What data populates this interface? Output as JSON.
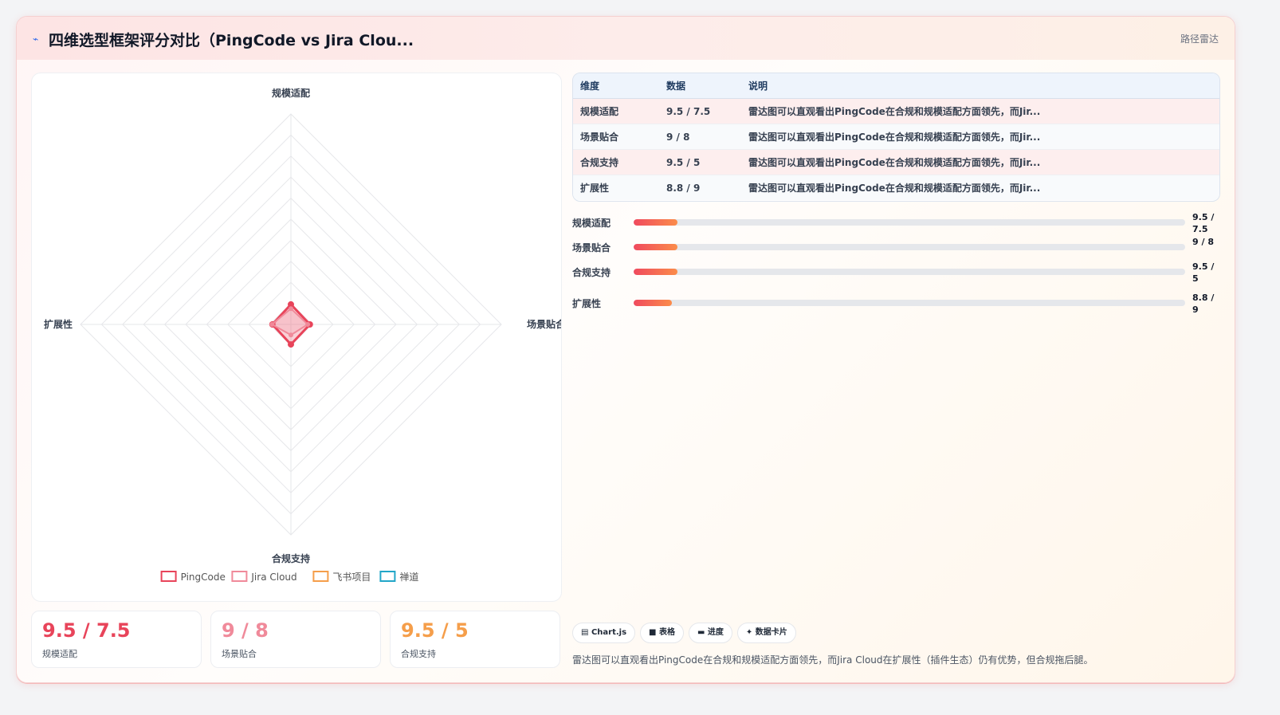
{
  "header": {
    "logo_icon": "chart-trend-icon",
    "title": "四维选型框架评分对比（PingCode vs Jira Clou...",
    "tag": "路径雷达"
  },
  "chart_data": {
    "type": "radar",
    "title": "",
    "axes": [
      "规模适配",
      "场景贴合",
      "合规支持",
      "扩展性"
    ],
    "range": [
      0,
      100
    ],
    "rings": 10,
    "series": [
      {
        "name": "PingCode",
        "values": [
          9.5,
          9,
          9.5,
          8.8
        ],
        "color": "#e8445a"
      },
      {
        "name": "Jira Cloud",
        "values": [
          7.5,
          8,
          5,
          9
        ],
        "color": "#f08a9a"
      },
      {
        "name": "飞书项目",
        "values": [],
        "color": "#f59e4a"
      },
      {
        "name": "禅道",
        "values": [],
        "color": "#22a6c8"
      }
    ],
    "legend_position": "bottom"
  },
  "table": {
    "headers": [
      "维度",
      "数据",
      "说明"
    ],
    "rows": [
      {
        "dim": "规模适配",
        "value": "9.5 / 7.5",
        "note": "雷达图可以直观看出PingCode在合规和规模适配方面领先，而Jir..."
      },
      {
        "dim": "场景贴合",
        "value": "9 / 8",
        "note": "雷达图可以直观看出PingCode在合规和规模适配方面领先，而Jir..."
      },
      {
        "dim": "合规支持",
        "value": "9.5 / 5",
        "note": "雷达图可以直观看出PingCode在合规和规模适配方面领先，而Jir..."
      },
      {
        "dim": "扩展性",
        "value": "8.8 / 9",
        "note": "雷达图可以直观看出PingCode在合规和规模适配方面领先，而Jir..."
      }
    ]
  },
  "progress": [
    {
      "label": "规模适配",
      "value_text": "9.5 / 7.5",
      "fraction": 0.08
    },
    {
      "label": "场景贴合",
      "value_text": "9 / 8",
      "fraction": 0.08
    },
    {
      "label": "合规支持",
      "value_text": "9.5 / 5",
      "fraction": 0.08
    },
    {
      "label": "扩展性",
      "value_text": "8.8 / 9",
      "fraction": 0.07
    }
  ],
  "stats": [
    {
      "value": "9.5 / 7.5",
      "label": "规模适配",
      "color": "#e8445a"
    },
    {
      "value": "9 / 8",
      "label": "场景贴合",
      "color": "#f08a9a"
    },
    {
      "value": "9.5 / 5",
      "label": "合规支持",
      "color": "#f59e4a"
    }
  ],
  "chips": [
    {
      "icon": "chart-icon",
      "glyph": "▤",
      "label": "Chart.js"
    },
    {
      "icon": "table-icon",
      "glyph": "■",
      "label": "表格"
    },
    {
      "icon": "progress-icon",
      "glyph": "▬",
      "label": "进度"
    },
    {
      "icon": "card-icon",
      "glyph": "✦",
      "label": "数据卡片"
    }
  ],
  "footnote": "雷达图可以直观看出PingCode在合规和规模适配方面领先，而Jira Cloud在扩展性（插件生态）仍有优势，但合规拖后腿。"
}
